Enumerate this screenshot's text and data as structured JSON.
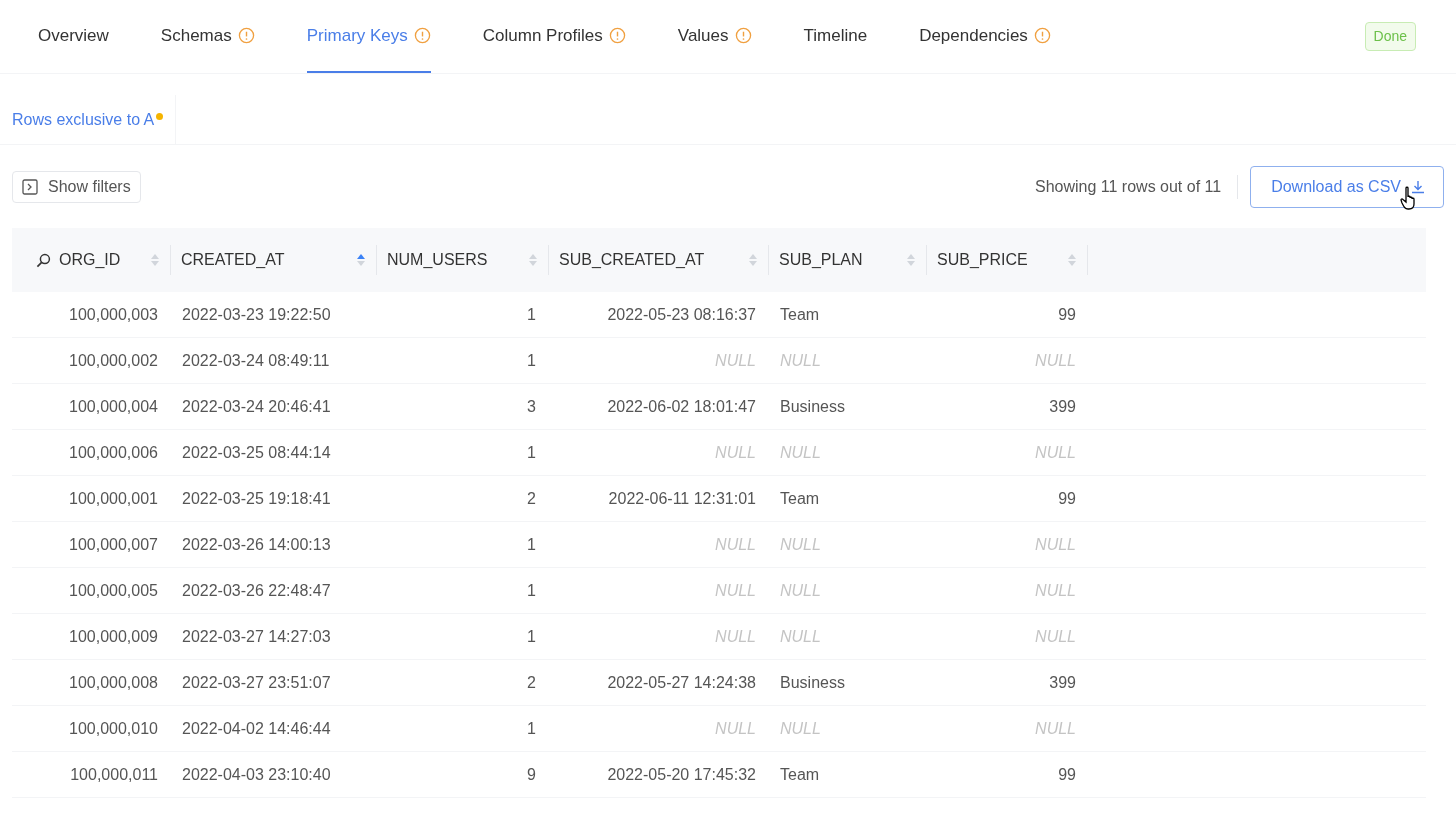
{
  "tabs": [
    {
      "label": "Overview",
      "warning": false,
      "selected": false
    },
    {
      "label": "Schemas",
      "warning": true,
      "selected": false
    },
    {
      "label": "Primary Keys",
      "warning": true,
      "selected": true
    },
    {
      "label": "Column Profiles",
      "warning": true,
      "selected": false
    },
    {
      "label": "Values",
      "warning": true,
      "selected": false
    },
    {
      "label": "Timeline",
      "warning": false,
      "selected": false
    },
    {
      "label": "Dependencies",
      "warning": true,
      "selected": false
    }
  ],
  "status_badge": "Done",
  "sub_tabs": [
    {
      "label": "Rows exclusive to A",
      "dot": true,
      "selected": true
    }
  ],
  "toolbar": {
    "filters_button": "Show filters",
    "row_count": "Showing 11 rows out of 11",
    "download_button": "Download as CSV"
  },
  "table": {
    "columns": [
      {
        "name": "ORG_ID",
        "search": true,
        "sorted_ascending": false
      },
      {
        "name": "CREATED_AT",
        "search": false,
        "sorted_ascending": true
      },
      {
        "name": "NUM_USERS",
        "search": false,
        "sorted_ascending": false
      },
      {
        "name": "SUB_CREATED_AT",
        "search": false,
        "sorted_ascending": false
      },
      {
        "name": "SUB_PLAN",
        "search": false,
        "sorted_ascending": false
      },
      {
        "name": "SUB_PRICE",
        "search": false,
        "sorted_ascending": false
      }
    ],
    "rows": [
      [
        {
          "text": "100,000,003",
          "null": false
        },
        {
          "text": "2022-03-23 19:22:50",
          "null": false
        },
        {
          "text": "1",
          "null": false
        },
        {
          "text": "2022-05-23 08:16:37",
          "null": false
        },
        {
          "text": "Team",
          "null": false
        },
        {
          "text": "99",
          "null": false
        }
      ],
      [
        {
          "text": "100,000,002",
          "null": false
        },
        {
          "text": "2022-03-24 08:49:11",
          "null": false
        },
        {
          "text": "1",
          "null": false
        },
        {
          "text": "NULL",
          "null": true
        },
        {
          "text": "NULL",
          "null": true
        },
        {
          "text": "NULL",
          "null": true
        }
      ],
      [
        {
          "text": "100,000,004",
          "null": false
        },
        {
          "text": "2022-03-24 20:46:41",
          "null": false
        },
        {
          "text": "3",
          "null": false
        },
        {
          "text": "2022-06-02 18:01:47",
          "null": false
        },
        {
          "text": "Business",
          "null": false
        },
        {
          "text": "399",
          "null": false
        }
      ],
      [
        {
          "text": "100,000,006",
          "null": false
        },
        {
          "text": "2022-03-25 08:44:14",
          "null": false
        },
        {
          "text": "1",
          "null": false
        },
        {
          "text": "NULL",
          "null": true
        },
        {
          "text": "NULL",
          "null": true
        },
        {
          "text": "NULL",
          "null": true
        }
      ],
      [
        {
          "text": "100,000,001",
          "null": false
        },
        {
          "text": "2022-03-25 19:18:41",
          "null": false
        },
        {
          "text": "2",
          "null": false
        },
        {
          "text": "2022-06-11 12:31:01",
          "null": false
        },
        {
          "text": "Team",
          "null": false
        },
        {
          "text": "99",
          "null": false
        }
      ],
      [
        {
          "text": "100,000,007",
          "null": false
        },
        {
          "text": "2022-03-26 14:00:13",
          "null": false
        },
        {
          "text": "1",
          "null": false
        },
        {
          "text": "NULL",
          "null": true
        },
        {
          "text": "NULL",
          "null": true
        },
        {
          "text": "NULL",
          "null": true
        }
      ],
      [
        {
          "text": "100,000,005",
          "null": false
        },
        {
          "text": "2022-03-26 22:48:47",
          "null": false
        },
        {
          "text": "1",
          "null": false
        },
        {
          "text": "NULL",
          "null": true
        },
        {
          "text": "NULL",
          "null": true
        },
        {
          "text": "NULL",
          "null": true
        }
      ],
      [
        {
          "text": "100,000,009",
          "null": false
        },
        {
          "text": "2022-03-27 14:27:03",
          "null": false
        },
        {
          "text": "1",
          "null": false
        },
        {
          "text": "NULL",
          "null": true
        },
        {
          "text": "NULL",
          "null": true
        },
        {
          "text": "NULL",
          "null": true
        }
      ],
      [
        {
          "text": "100,000,008",
          "null": false
        },
        {
          "text": "2022-03-27 23:51:07",
          "null": false
        },
        {
          "text": "2",
          "null": false
        },
        {
          "text": "2022-05-27 14:24:38",
          "null": false
        },
        {
          "text": "Business",
          "null": false
        },
        {
          "text": "399",
          "null": false
        }
      ],
      [
        {
          "text": "100,000,010",
          "null": false
        },
        {
          "text": "2022-04-02 14:46:44",
          "null": false
        },
        {
          "text": "1",
          "null": false
        },
        {
          "text": "NULL",
          "null": true
        },
        {
          "text": "NULL",
          "null": true
        },
        {
          "text": "NULL",
          "null": true
        }
      ],
      [
        {
          "text": "100,000,011",
          "null": false
        },
        {
          "text": "2022-04-03 23:10:40",
          "null": false
        },
        {
          "text": "9",
          "null": false
        },
        {
          "text": "2022-05-20 17:45:32",
          "null": false
        },
        {
          "text": "Team",
          "null": false
        },
        {
          "text": "99",
          "null": false
        }
      ]
    ]
  }
}
